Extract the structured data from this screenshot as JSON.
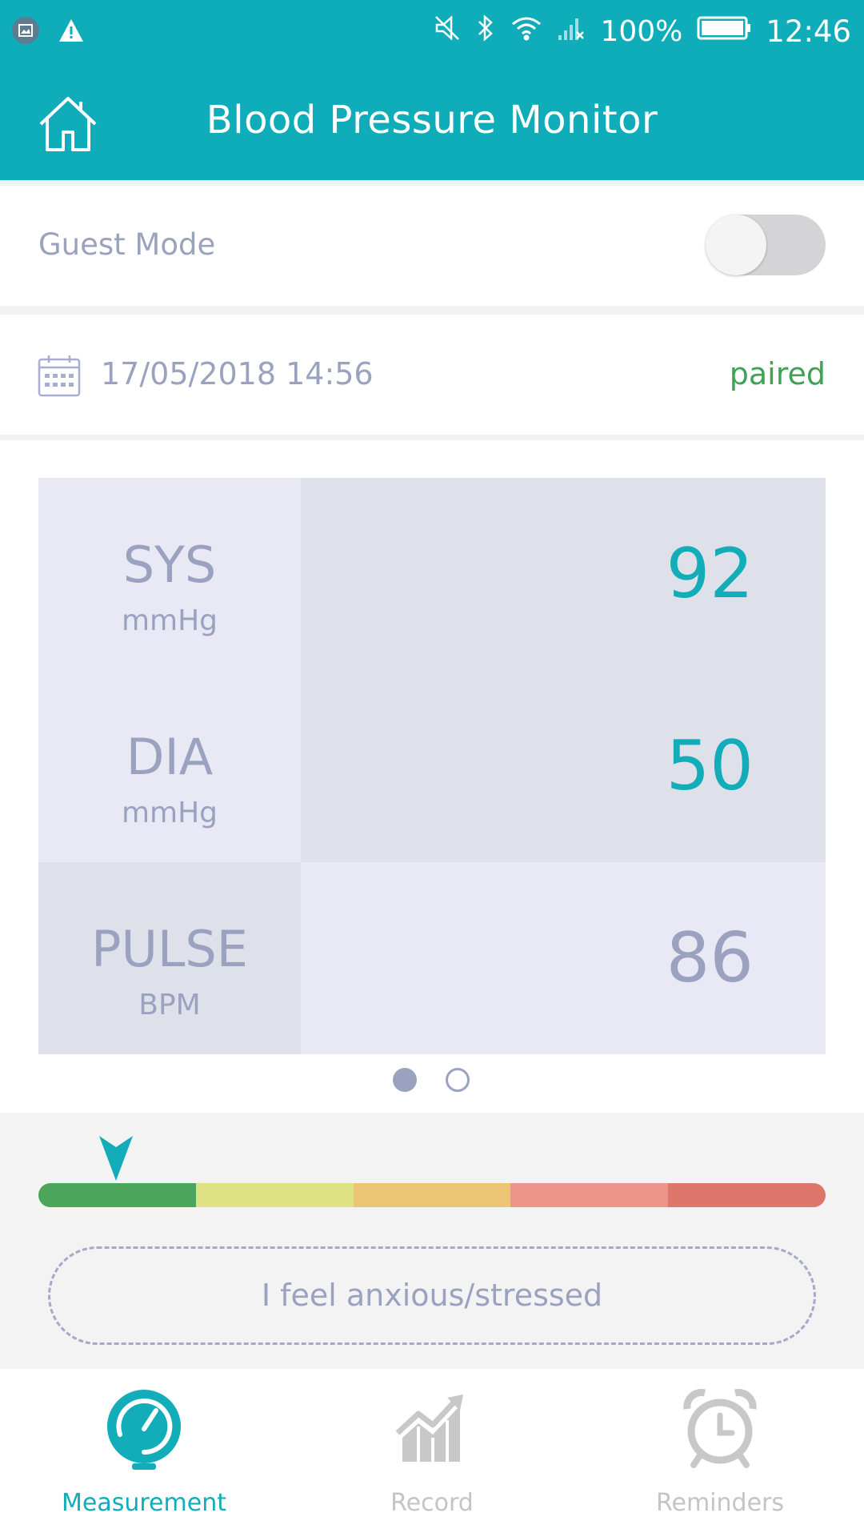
{
  "status_bar": {
    "battery": "100%",
    "time": "12:46"
  },
  "header": {
    "title": "Blood Pressure Monitor"
  },
  "guest_mode": {
    "label": "Guest Mode",
    "enabled": false
  },
  "measurement": {
    "datetime": "17/05/2018  14:56",
    "status": "paired",
    "readings": [
      {
        "label": "SYS",
        "unit": "mmHg",
        "value": "92"
      },
      {
        "label": "DIA",
        "unit": "mmHg",
        "value": "50"
      },
      {
        "label": "PULSE",
        "unit": "BPM",
        "value": "86"
      }
    ],
    "page_indicator": {
      "current": 1,
      "total": 2
    }
  },
  "scale": {
    "segment_colors": [
      "#4ba55a",
      "#dfe185",
      "#ecc476",
      "#ec948a",
      "#dd776b"
    ],
    "pointer_position_fraction": 0.1,
    "accent": "#12adb9"
  },
  "feel_button": {
    "label": "I feel anxious/stressed"
  },
  "bottom_nav": {
    "items": [
      {
        "label": "Measurement",
        "icon": "gauge-icon",
        "active": true
      },
      {
        "label": "Record",
        "icon": "chart-icon",
        "active": false
      },
      {
        "label": "Reminders",
        "icon": "alarm-clock-icon",
        "active": false
      }
    ]
  }
}
